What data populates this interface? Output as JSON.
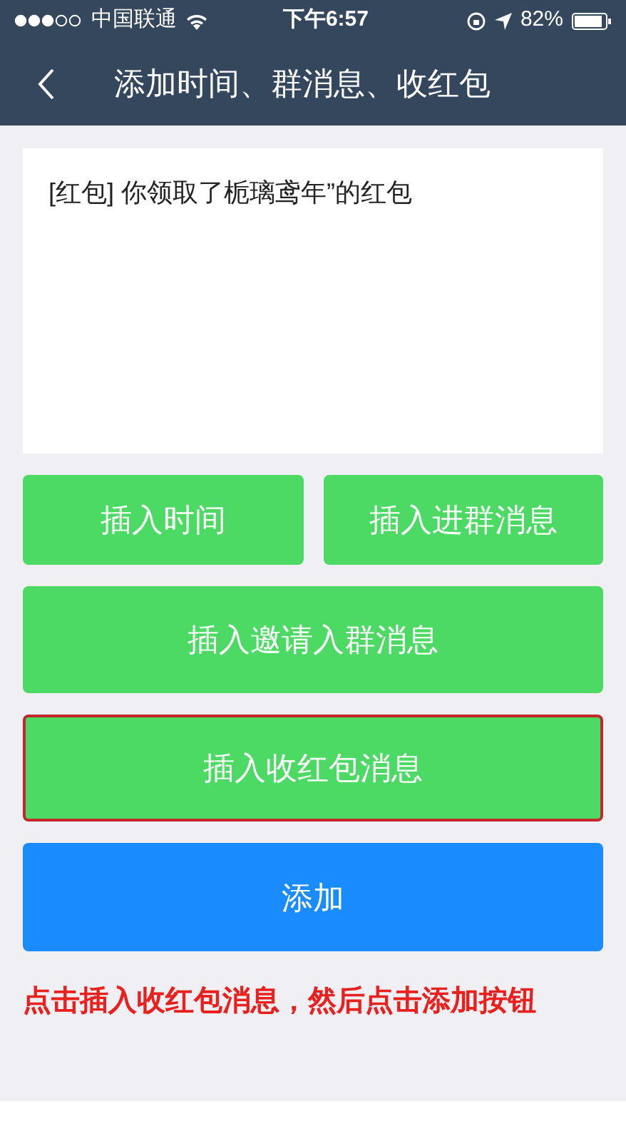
{
  "status_bar": {
    "carrier": "中国联通",
    "time": "下午6:57",
    "battery": "82%"
  },
  "nav": {
    "title": "添加时间、群消息、收红包"
  },
  "message_box": {
    "value": "[红包]  你领取了栀璃鸢年”的红包"
  },
  "button_rows": [
    [
      {
        "label": "插入时间",
        "highlighted": false
      },
      {
        "label": "插入进群消息",
        "highlighted": false
      }
    ],
    [
      {
        "label": "插入邀请入群消息",
        "highlighted": false
      }
    ],
    [
      {
        "label": "插入收红包消息",
        "highlighted": true
      }
    ]
  ],
  "add_button": {
    "label": "添加"
  },
  "instruction": "点击插入收红包消息，然后点击添加按钮"
}
